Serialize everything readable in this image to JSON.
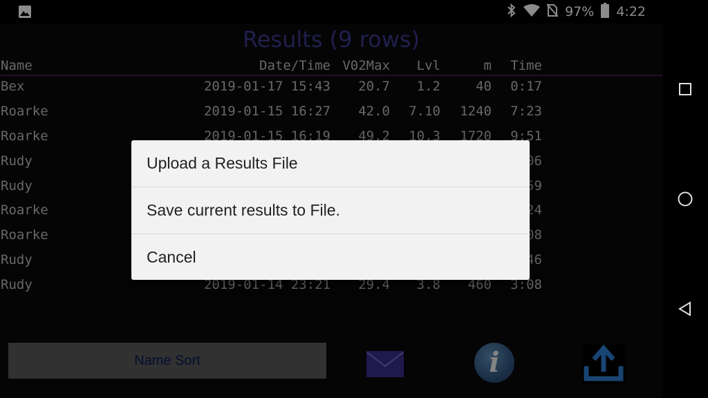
{
  "status": {
    "battery": "97%",
    "time": "4:22",
    "icons": [
      "image-icon",
      "bluetooth-icon",
      "wifi-icon",
      "no-sim-icon",
      "battery-icon"
    ]
  },
  "title": "Results (9 rows)",
  "table": {
    "headers": {
      "name": "Name",
      "date": "Date/Time",
      "vo2": "V02Max",
      "lvl": "Lvl",
      "m": "m",
      "time": "Time"
    },
    "rows": [
      {
        "name": "Bex",
        "date": "2019-01-17 15:43",
        "vo2": "20.7",
        "lvl": "1.2",
        "m": "40",
        "time": "0:17"
      },
      {
        "name": "Roarke",
        "date": "2019-01-15 16:27",
        "vo2": "42.0",
        "lvl": "7.10",
        "m": "1240",
        "time": "7:23"
      },
      {
        "name": "Roarke",
        "date": "2019-01-15 16:19",
        "vo2": "49.2",
        "lvl": "10.3",
        "m": "1720",
        "time": "9:51"
      },
      {
        "name": "Rudy",
        "date": "",
        "vo2": "",
        "lvl": "",
        "m": "",
        "time": "06"
      },
      {
        "name": "Rudy",
        "date": "",
        "vo2": "",
        "lvl": "",
        "m": "",
        "time": "59"
      },
      {
        "name": "Roarke",
        "date": "",
        "vo2": "",
        "lvl": "",
        "m": "",
        "time": "24"
      },
      {
        "name": "Roarke",
        "date": "",
        "vo2": "",
        "lvl": "",
        "m": "",
        "time": "08"
      },
      {
        "name": "Rudy",
        "date": "",
        "vo2": "",
        "lvl": "",
        "m": "",
        "time": "46"
      },
      {
        "name": "Rudy",
        "date": "2019-01-14 23:21",
        "vo2": "29.4",
        "lvl": "3.8",
        "m": "460",
        "time": "3:08"
      }
    ]
  },
  "bottom": {
    "name_sort": "Name Sort",
    "info_glyph": "i"
  },
  "dialog": {
    "items": [
      "Upload a Results File",
      "Save current results to File.",
      "Cancel"
    ]
  },
  "colors": {
    "title": "#3c3a8c",
    "mail": "#3a2f8a",
    "upload": "#2f7fd0"
  }
}
